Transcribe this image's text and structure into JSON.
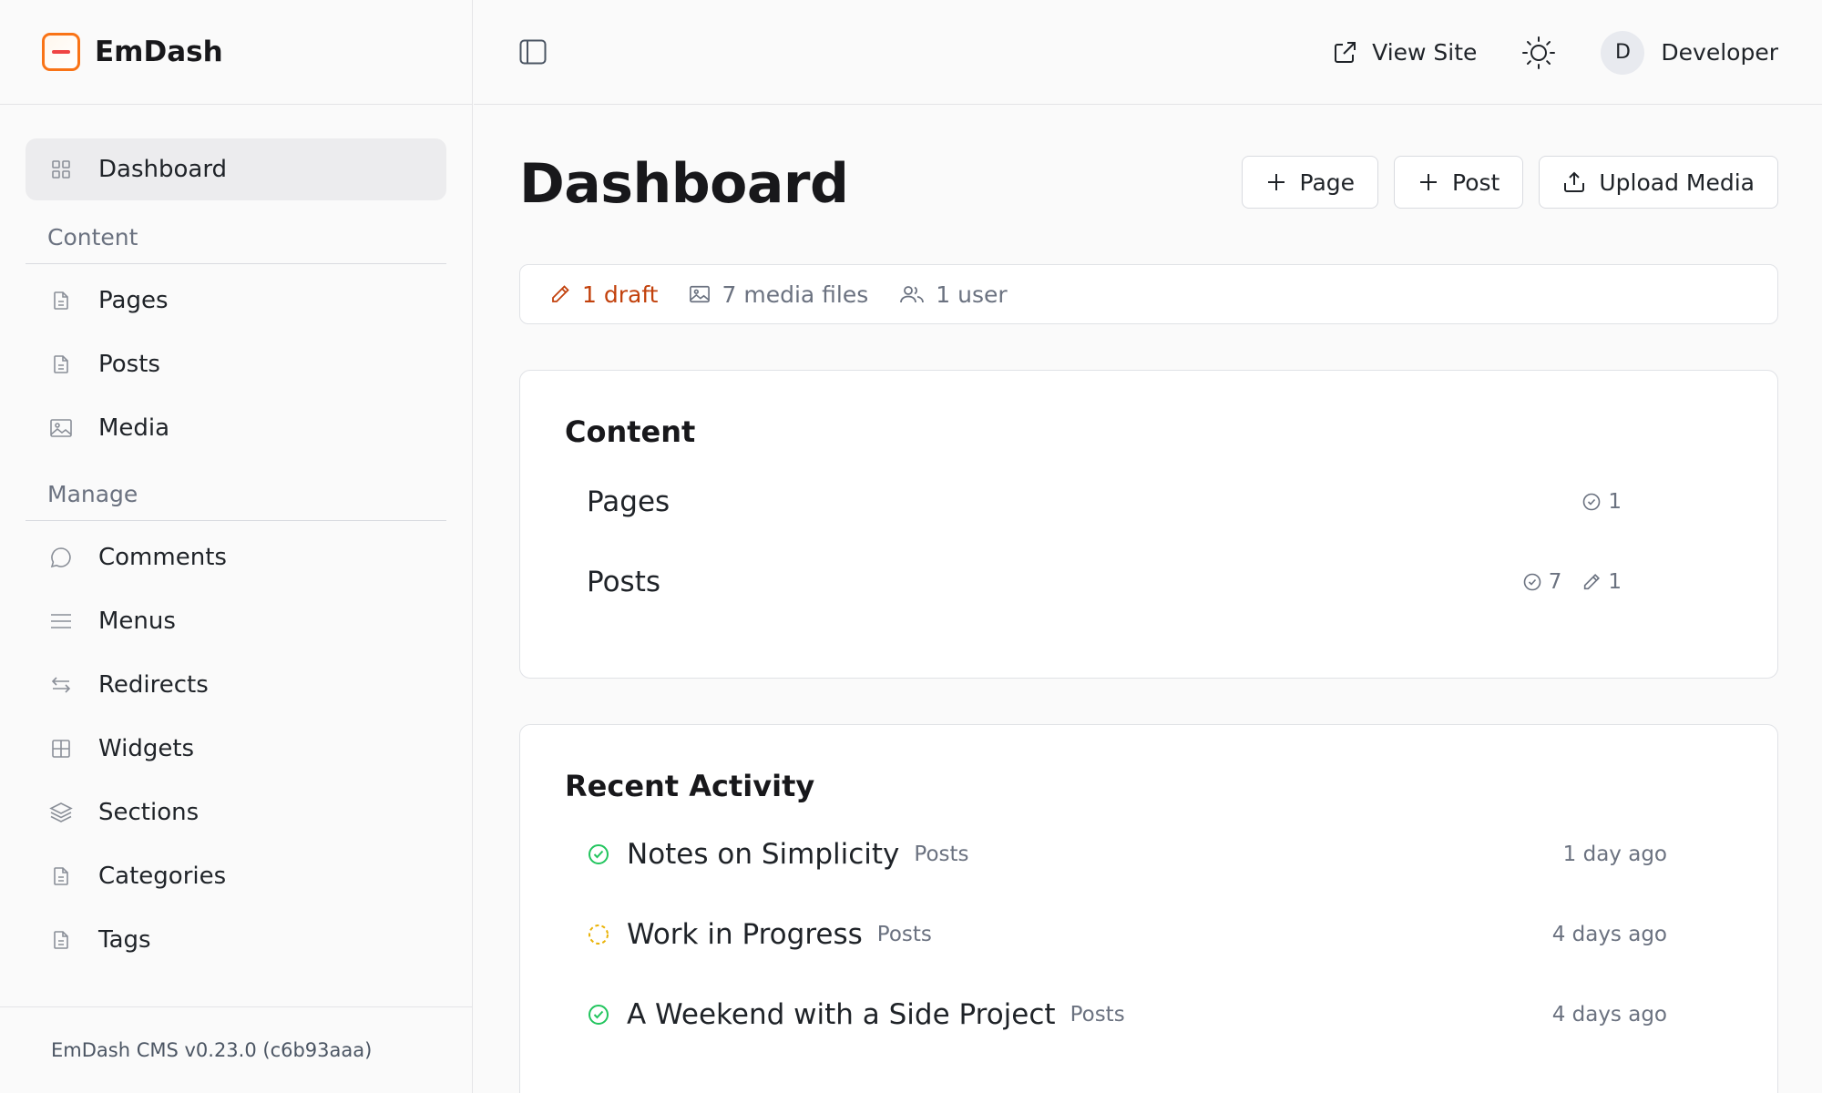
{
  "brand": {
    "name": "EmDash"
  },
  "sidebar": {
    "dashboard": "Dashboard",
    "sections": [
      {
        "title": "Content",
        "items": [
          {
            "label": "Pages",
            "icon": "file-icon"
          },
          {
            "label": "Posts",
            "icon": "file-icon"
          },
          {
            "label": "Media",
            "icon": "image-icon"
          }
        ]
      },
      {
        "title": "Manage",
        "items": [
          {
            "label": "Comments",
            "icon": "comment-icon"
          },
          {
            "label": "Menus",
            "icon": "menu-icon"
          },
          {
            "label": "Redirects",
            "icon": "arrows-icon"
          },
          {
            "label": "Widgets",
            "icon": "grid-icon"
          },
          {
            "label": "Sections",
            "icon": "layers-icon"
          },
          {
            "label": "Categories",
            "icon": "file-icon"
          },
          {
            "label": "Tags",
            "icon": "file-icon"
          }
        ]
      }
    ],
    "footer": "EmDash CMS v0.23.0 (c6b93aaa)"
  },
  "topbar": {
    "view_site": "View Site",
    "user_initial": "D",
    "user_name": "Developer"
  },
  "page": {
    "title": "Dashboard",
    "actions": {
      "page": "Page",
      "post": "Post",
      "upload": "Upload Media"
    }
  },
  "stats": {
    "drafts": "1 draft",
    "media": "7 media files",
    "users": "1 user"
  },
  "content": {
    "title": "Content",
    "rows": [
      {
        "name": "Pages",
        "published": "1",
        "drafts": null
      },
      {
        "name": "Posts",
        "published": "7",
        "drafts": "1"
      }
    ]
  },
  "activity": {
    "title": "Recent Activity",
    "rows": [
      {
        "title": "Notes on Simplicity",
        "collection": "Posts",
        "time": "1 day ago",
        "status": "published"
      },
      {
        "title": "Work in Progress",
        "collection": "Posts",
        "time": "4 days ago",
        "status": "draft"
      },
      {
        "title": "A Weekend with a Side Project",
        "collection": "Posts",
        "time": "4 days ago",
        "status": "published"
      }
    ]
  },
  "colors": {
    "accent": "#f97316",
    "draft": "#c2410c",
    "published": "#22c55e",
    "draft_status": "#eab308"
  }
}
